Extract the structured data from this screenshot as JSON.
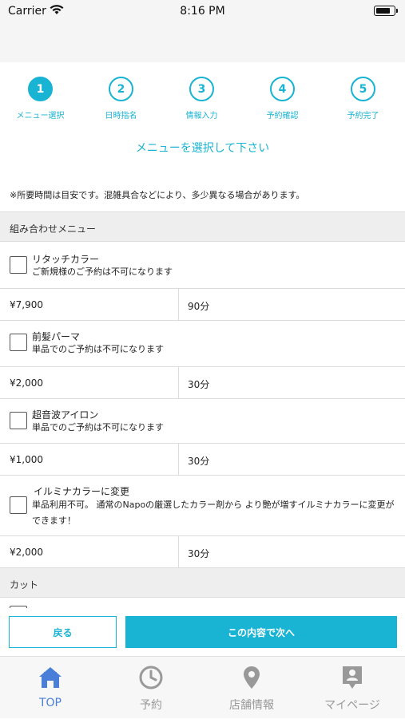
{
  "status_bar": {
    "carrier": "Carrier",
    "time": "8:16 PM"
  },
  "steps": [
    {
      "number": "1",
      "label": "メニュー選択"
    },
    {
      "number": "2",
      "label": "日時指名"
    },
    {
      "number": "3",
      "label": "情報入力"
    },
    {
      "number": "4",
      "label": "予約確認"
    },
    {
      "number": "5",
      "label": "予約完了"
    }
  ],
  "current_step": 1,
  "instruction": "メニューを選択して下さい",
  "note": "※所要時間は目安です。混雑具合などにより、多少異なる場合があります。",
  "sections": {
    "combo": "組み合わせメニュー",
    "cut": "カット"
  },
  "menu_items": [
    {
      "title": "リタッチカラー",
      "description": "ご新規様のご予約は不可になります",
      "price": "¥7,900",
      "duration": "90分"
    },
    {
      "title": "前髪パーマ",
      "description": "単品でのご予約は不可になります",
      "price": "¥2,000",
      "duration": "30分"
    },
    {
      "title": "超音波アイロン",
      "description": "単品でのご予約は不可になります",
      "price": "¥1,000",
      "duration": "30分"
    },
    {
      "title": "イルミナカラーに変更",
      "description": "単品利用不可。 通常のNapoの厳選したカラー剤から より艶が増すイルミナカラーに変更ができます！",
      "price": "¥2,000",
      "duration": "30分"
    }
  ],
  "actions": {
    "back": "戻る",
    "next": "この内容で次へ"
  },
  "tabs": [
    {
      "label": "TOP",
      "icon": "home-icon"
    },
    {
      "label": "予約",
      "icon": "clock-icon"
    },
    {
      "label": "店舗情報",
      "icon": "map-pin-icon"
    },
    {
      "label": "マイページ",
      "icon": "profile-icon"
    }
  ],
  "active_tab": "TOP",
  "colors": {
    "accent": "#19b3d3",
    "tab_active": "#4a7fd9",
    "tab_inactive": "#999999"
  }
}
